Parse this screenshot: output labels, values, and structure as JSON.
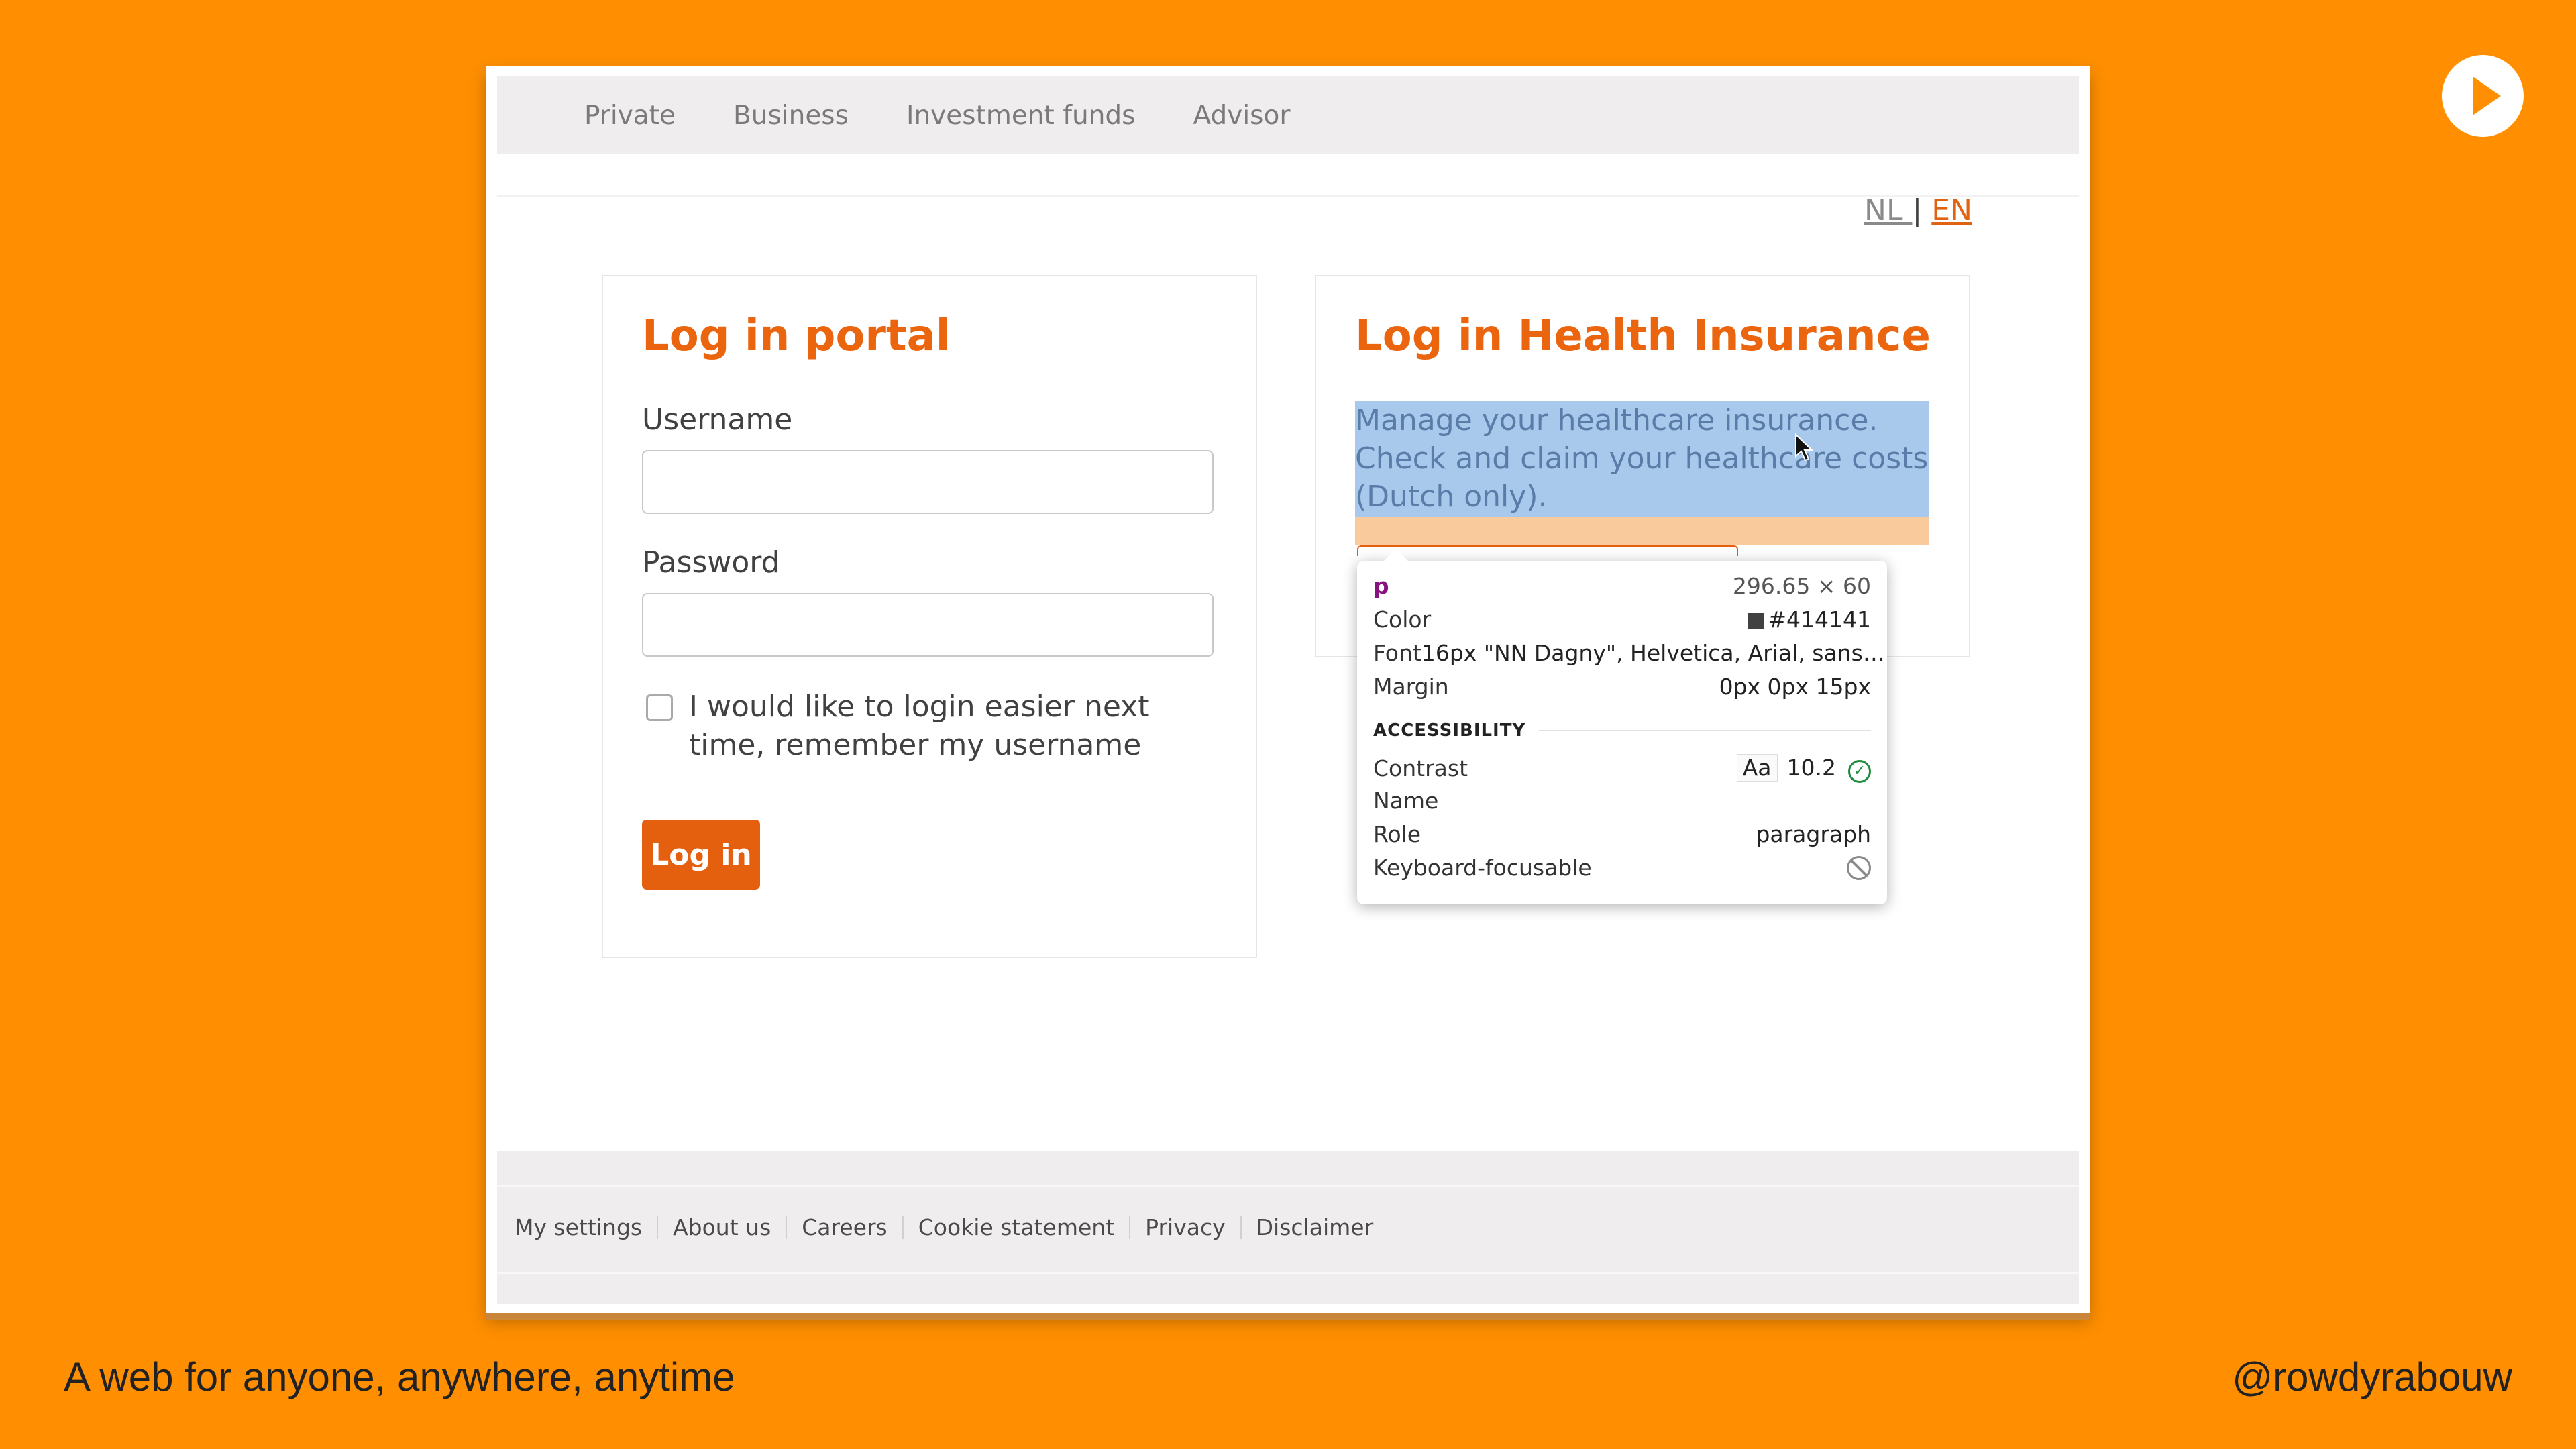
{
  "nav": {
    "items": [
      "Private",
      "Business",
      "Investment funds",
      "Advisor"
    ]
  },
  "lang": {
    "nl": "NL ",
    "sep": "|",
    "en": "EN"
  },
  "portal": {
    "title": "Log in portal",
    "username_label": "Username",
    "password_label": "Password",
    "remember_label": "I would like to login easier next time, remember my username",
    "login_button": "Log in"
  },
  "health": {
    "title": "Log in Health Insurance",
    "description": "Manage your healthcare insurance. Check and claim your healthcare costs (Dutch only)."
  },
  "inspector": {
    "tag": "p",
    "dimensions": "296.65 × 60",
    "color_label": "Color",
    "color_value": "#414141",
    "font_label": "Font",
    "font_value": "16px \"NN Dagny\", Helvetica, Arial, sans…",
    "margin_label": "Margin",
    "margin_value": "0px 0px 15px",
    "accessibility_heading": "ACCESSIBILITY",
    "contrast_label": "Contrast",
    "contrast_sample": "Aa",
    "contrast_value": "10.2",
    "name_label": "Name",
    "role_label": "Role",
    "role_value": "paragraph",
    "focusable_label": "Keyboard-focusable"
  },
  "footer": {
    "links": [
      "My settings",
      "About us",
      "Careers",
      "Cookie statement",
      "Privacy",
      "Disclaimer"
    ]
  },
  "slide": {
    "caption": "A web for anyone, anywhere, anytime",
    "handle": "@rowdyrabouw"
  },
  "colors": {
    "background": "#ff8f00",
    "accent": "#ea650d",
    "button": "#e4600e",
    "text": "#414141"
  }
}
